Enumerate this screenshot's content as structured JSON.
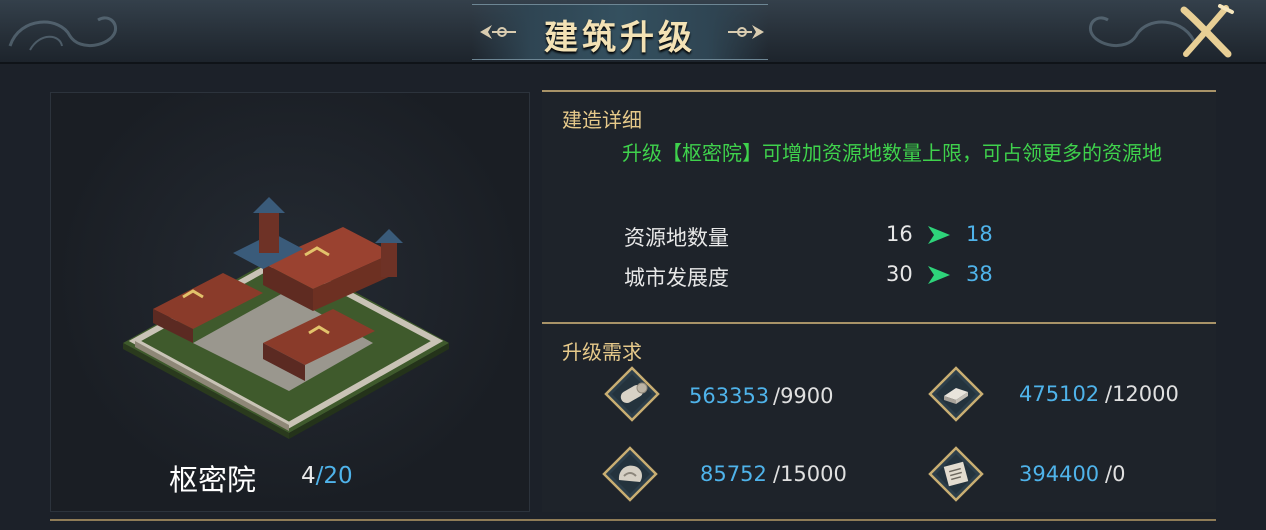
{
  "window": {
    "title": "建筑升级",
    "close_icon": "close-x-icon"
  },
  "building": {
    "name": "枢密院",
    "level_current": "4",
    "level_separator": "/",
    "level_max": "20"
  },
  "details": {
    "title": "建造详细",
    "description": "升级【枢密院】可增加资源地数量上限，可占领更多的资源地",
    "stats": [
      {
        "label": "资源地数量",
        "old": "16",
        "new": "18"
      },
      {
        "label": "城市发展度",
        "old": "30",
        "new": "38"
      }
    ]
  },
  "requirements": {
    "title": "升级需求",
    "items": [
      {
        "icon": "wood-icon",
        "have": "563353",
        "need": "/9900"
      },
      {
        "icon": "iron-icon",
        "have": "475102",
        "need": "/12000"
      },
      {
        "icon": "stone-icon",
        "have": "85752",
        "need": "/15000"
      },
      {
        "icon": "scroll-icon",
        "have": "394400",
        "need": "/0"
      }
    ]
  },
  "colors": {
    "accent_gold": "#e6c98a",
    "value_blue": "#4fb3ea",
    "desc_green": "#3fd24c",
    "arrow_green": "#2ed47a"
  }
}
